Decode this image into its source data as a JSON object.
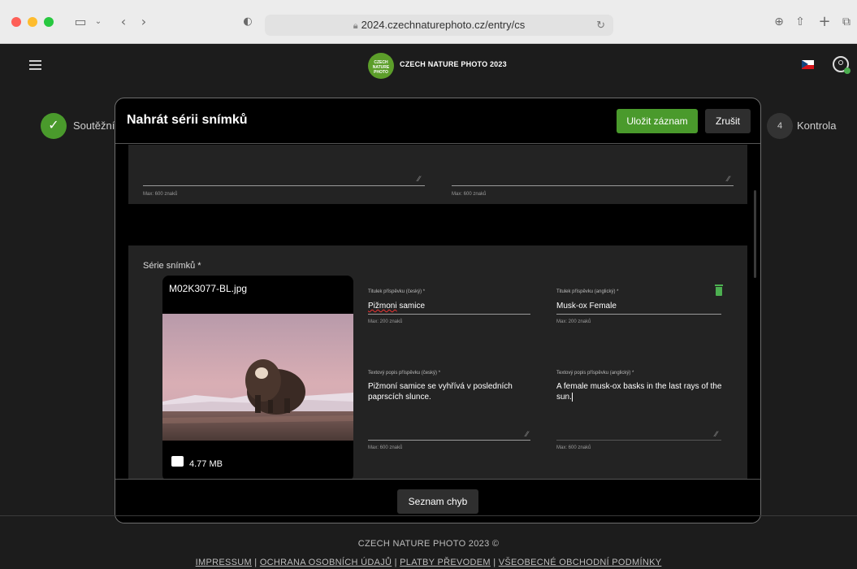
{
  "browser": {
    "url": "2024.czechnaturephoto.cz/entry/cs"
  },
  "header": {
    "logo_text": "CZECH NATURE PHOTO",
    "site_title": "CZECH NATURE PHOTO 2023"
  },
  "stepper": {
    "step1_label": "Soutěžní",
    "step4_number": "4",
    "step4_label": "Kontrola"
  },
  "modal": {
    "title": "Nahrát sérii snímků",
    "save_label": "Uložit záznam",
    "cancel_label": "Zrušit",
    "top_hint_left": "Max: 600 znaků",
    "top_hint_right": "Max: 600 znaků",
    "series_label": "Série snímků *",
    "photo": {
      "filename": "M02K3077-BL.jpg",
      "size": "4.77 MB"
    },
    "fields": {
      "title_cs_label": "Titulek příspěvku (český) *",
      "title_cs_value_a": "Pižmoni",
      "title_cs_value_b": " samice",
      "title_cs_hint": "Max: 200 znaků",
      "title_en_label": "Titulek příspěvku (anglický) *",
      "title_en_value": "Musk-ox Female",
      "title_en_hint": "Max: 200 znaků",
      "desc_cs_label": "Textový popis příspěvku (český) *",
      "desc_cs_value": "Pižmoní samice se vyhřívá v posledních paprscích slunce.",
      "desc_cs_hint": "Max: 600 znaků",
      "desc_en_label": "Textový popis příspěvku (anglický) *",
      "desc_en_value": "A female musk-ox basks in the last rays of the sun.",
      "desc_en_hint": "Max: 600 znaků"
    },
    "errors_label": "Seznam chyb"
  },
  "footer": {
    "copyright": "CZECH NATURE PHOTO 2023 ©",
    "links": [
      "IMPRESSUM",
      "OCHRANA OSOBNÍCH ÚDAJŮ",
      "PLATBY PŘEVODEM",
      "VŠEOBECNÉ OBCHODNÍ PODMÍNKY"
    ],
    "separator": " | "
  },
  "colors": {
    "accent": "#4a9a2c",
    "background": "#1c1c1c",
    "modal": "#000000",
    "panel": "#232323"
  }
}
